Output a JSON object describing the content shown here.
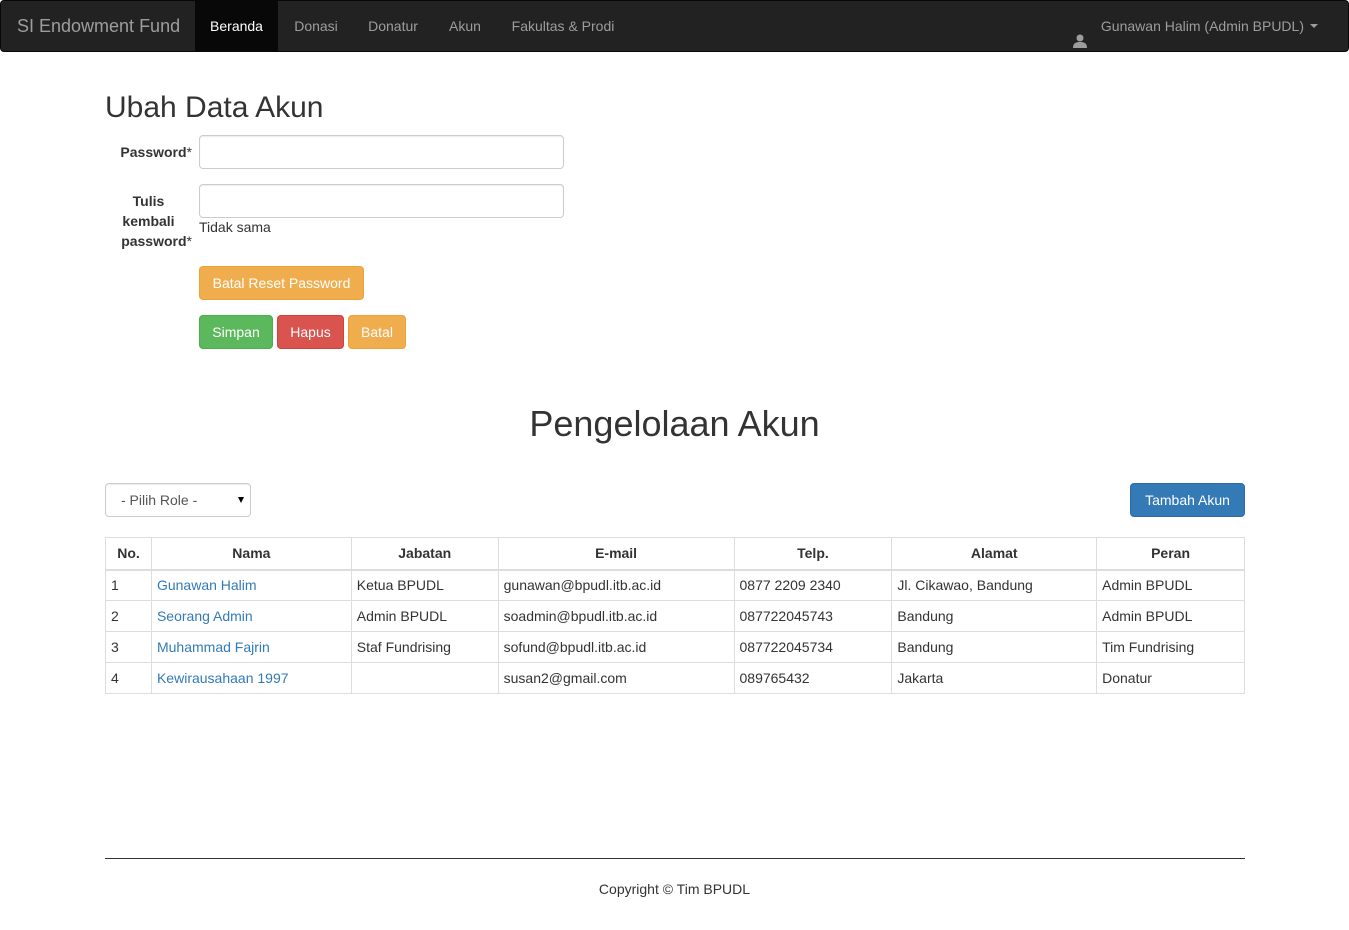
{
  "navbar": {
    "brand": "SI Endowment Fund",
    "items": [
      {
        "label": "Beranda",
        "active": true
      },
      {
        "label": "Donasi",
        "active": false
      },
      {
        "label": "Donatur",
        "active": false
      },
      {
        "label": "Akun",
        "active": false
      },
      {
        "label": "Fakultas & Prodi",
        "active": false
      }
    ],
    "user": {
      "name": "Gunawan Halim (Admin BPUDL)",
      "icon": "user-icon"
    }
  },
  "form": {
    "title": "Ubah Data Akun",
    "password_label": "Password",
    "password_value": "",
    "retype_label_line1": "Tulis",
    "retype_label_line2": "kembali",
    "retype_label_line3": "password",
    "required_mark": "*",
    "retype_value": "",
    "help_text": "Tidak sama",
    "cancel_reset_label": "Batal Reset Password",
    "save_label": "Simpan",
    "delete_label": "Hapus",
    "cancel_label": "Batal"
  },
  "accounts": {
    "title": "Pengelolaan Akun",
    "role_select": {
      "selected": "- Pilih Role -"
    },
    "add_button": "Tambah Akun",
    "columns": [
      "No.",
      "Nama",
      "Jabatan",
      "E-mail",
      "Telp.",
      "Alamat",
      "Peran"
    ],
    "rows": [
      {
        "no": "1",
        "nama": "Gunawan Halim",
        "jabatan": "Ketua BPUDL",
        "email": "gunawan@bpudl.itb.ac.id",
        "telp": "0877 2209 2340",
        "alamat": "Jl. Cikawao, Bandung",
        "peran": "Admin BPUDL"
      },
      {
        "no": "2",
        "nama": "Seorang Admin",
        "jabatan": "Admin BPUDL",
        "email": "soadmin@bpudl.itb.ac.id",
        "telp": "087722045743",
        "alamat": "Bandung",
        "peran": "Admin BPUDL"
      },
      {
        "no": "3",
        "nama": "Muhammad Fajrin",
        "jabatan": "Staf Fundrising",
        "email": "sofund@bpudl.itb.ac.id",
        "telp": "087722045734",
        "alamat": "Bandung",
        "peran": "Tim Fundrising"
      },
      {
        "no": "4",
        "nama": "Kewirausahaan 1997",
        "jabatan": "",
        "email": "susan2@gmail.com",
        "telp": "089765432",
        "alamat": "Jakarta",
        "peran": "Donatur"
      }
    ]
  },
  "footer": {
    "text": "Copyright © Tim BPUDL"
  },
  "colors": {
    "navbar_bg": "#222222",
    "link": "#337ab7",
    "success": "#5cb85c",
    "danger": "#d9534f",
    "warning": "#f0ad4e",
    "primary": "#337ab7"
  }
}
